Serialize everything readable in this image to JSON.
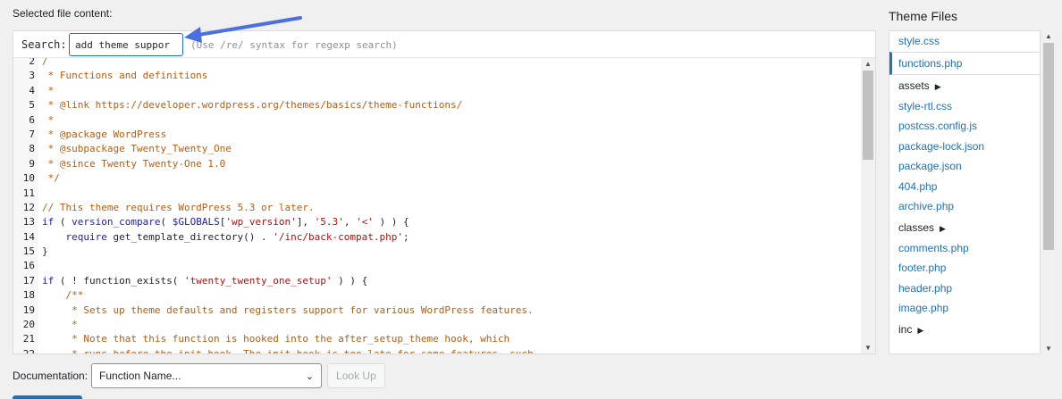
{
  "labels": {
    "selected_file_content": "Selected file content:",
    "search": "Search:",
    "search_hint": "(Use /re/ syntax for regexp search)"
  },
  "search": {
    "value": "add theme suppor"
  },
  "code_lines": [
    {
      "n": "2",
      "parts": [
        {
          "c": "t-comment",
          "t": "/"
        }
      ]
    },
    {
      "n": "3",
      "parts": [
        {
          "c": "t-comment",
          "t": " * Functions and definitions"
        }
      ]
    },
    {
      "n": "4",
      "parts": [
        {
          "c": "t-comment",
          "t": " *"
        }
      ]
    },
    {
      "n": "5",
      "parts": [
        {
          "c": "t-comment",
          "t": " * @link https://developer.wordpress.org/themes/basics/theme-functions/"
        }
      ]
    },
    {
      "n": "6",
      "parts": [
        {
          "c": "t-comment",
          "t": " *"
        }
      ]
    },
    {
      "n": "7",
      "parts": [
        {
          "c": "t-comment",
          "t": " * @package WordPress"
        }
      ]
    },
    {
      "n": "8",
      "parts": [
        {
          "c": "t-comment",
          "t": " * @subpackage Twenty_Twenty_One"
        }
      ]
    },
    {
      "n": "9",
      "parts": [
        {
          "c": "t-comment",
          "t": " * @since Twenty Twenty-One 1.0"
        }
      ]
    },
    {
      "n": "10",
      "parts": [
        {
          "c": "t-comment",
          "t": " */"
        }
      ]
    },
    {
      "n": "11",
      "parts": []
    },
    {
      "n": "12",
      "parts": [
        {
          "c": "t-comment",
          "t": "// This theme requires WordPress 5.3 or later."
        }
      ]
    },
    {
      "n": "13",
      "parts": [
        {
          "c": "t-kw",
          "t": "if"
        },
        {
          "c": "t-plain",
          "t": " ( "
        },
        {
          "c": "t-fn",
          "t": "version_compare"
        },
        {
          "c": "t-plain",
          "t": "( "
        },
        {
          "c": "t-var",
          "t": "$GLOBALS"
        },
        {
          "c": "t-plain",
          "t": "["
        },
        {
          "c": "t-str",
          "t": "'wp_version'"
        },
        {
          "c": "t-plain",
          "t": "], "
        },
        {
          "c": "t-str",
          "t": "'5.3'"
        },
        {
          "c": "t-plain",
          "t": ", "
        },
        {
          "c": "t-str",
          "t": "'<'"
        },
        {
          "c": "t-plain",
          "t": " ) ) {"
        }
      ]
    },
    {
      "n": "14",
      "parts": [
        {
          "c": "t-plain",
          "t": "    "
        },
        {
          "c": "t-kw",
          "t": "require"
        },
        {
          "c": "t-plain",
          "t": " get_template_directory() . "
        },
        {
          "c": "t-str",
          "t": "'/inc/back-compat.php'"
        },
        {
          "c": "t-plain",
          "t": ";"
        }
      ]
    },
    {
      "n": "15",
      "parts": [
        {
          "c": "t-plain",
          "t": "}"
        }
      ]
    },
    {
      "n": "16",
      "parts": []
    },
    {
      "n": "17",
      "parts": [
        {
          "c": "t-kw",
          "t": "if"
        },
        {
          "c": "t-plain",
          "t": " ( ! function_exists( "
        },
        {
          "c": "t-str",
          "t": "'twenty_twenty_one_setup'"
        },
        {
          "c": "t-plain",
          "t": " ) ) {"
        }
      ]
    },
    {
      "n": "18",
      "parts": [
        {
          "c": "t-comment",
          "t": "    /**"
        }
      ]
    },
    {
      "n": "19",
      "parts": [
        {
          "c": "t-comment",
          "t": "     * Sets up theme defaults and registers support for various WordPress features."
        }
      ]
    },
    {
      "n": "20",
      "parts": [
        {
          "c": "t-comment",
          "t": "     *"
        }
      ]
    },
    {
      "n": "21",
      "parts": [
        {
          "c": "t-comment",
          "t": "     * Note that this function is hooked into the after_setup_theme hook, which"
        }
      ]
    },
    {
      "n": "22",
      "parts": [
        {
          "c": "t-comment",
          "t": "     * runs before the init hook. The init hook is too late for some features, such"
        }
      ]
    }
  ],
  "theme_files": {
    "title": "Theme Files",
    "items": [
      {
        "label": "style.css",
        "type": "file",
        "active": false
      },
      {
        "label": "functions.php",
        "type": "file",
        "active": true
      },
      {
        "label": "assets",
        "type": "folder",
        "active": false
      },
      {
        "label": "style-rtl.css",
        "type": "file",
        "active": false
      },
      {
        "label": "postcss.config.js",
        "type": "file",
        "active": false
      },
      {
        "label": "package-lock.json",
        "type": "file",
        "active": false
      },
      {
        "label": "package.json",
        "type": "file",
        "active": false
      },
      {
        "label": "404.php",
        "type": "file",
        "active": false
      },
      {
        "label": "archive.php",
        "type": "file",
        "active": false
      },
      {
        "label": "classes",
        "type": "folder",
        "active": false
      },
      {
        "label": "comments.php",
        "type": "file",
        "active": false
      },
      {
        "label": "footer.php",
        "type": "file",
        "active": false
      },
      {
        "label": "header.php",
        "type": "file",
        "active": false
      },
      {
        "label": "image.php",
        "type": "file",
        "active": false
      },
      {
        "label": "inc",
        "type": "folder",
        "active": false
      }
    ]
  },
  "documentation": {
    "label": "Documentation:",
    "select_value": "Function Name...",
    "lookup_label": "Look Up"
  },
  "colors": {
    "accent": "#2271b1",
    "arrow": "#4a6fe0"
  }
}
